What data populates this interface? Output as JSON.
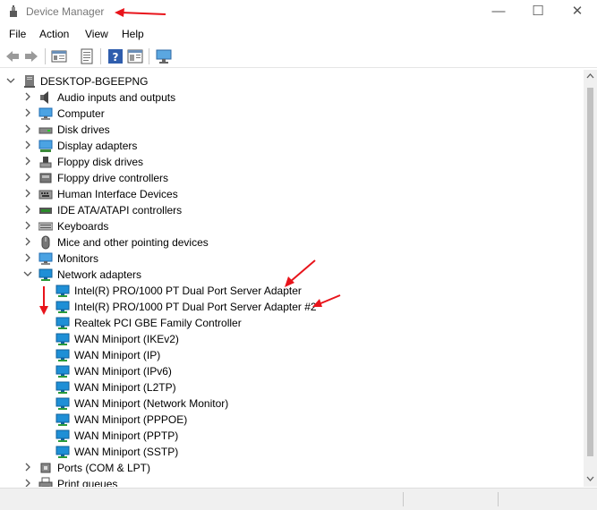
{
  "window": {
    "title": "Device Manager",
    "minimize_glyph": "—",
    "maximize_glyph": "☐",
    "close_glyph": "✕"
  },
  "menu": [
    "File",
    "Action",
    "View",
    "Help"
  ],
  "toolbar_icons": [
    "back-icon",
    "forward-icon",
    "properties-icon",
    "show-hidden-icon",
    "help-icon",
    "action-pane-icon",
    "monitor-icon"
  ],
  "tree": {
    "root": "DESKTOP-BGEEPNG",
    "categories": [
      {
        "label": "Audio inputs and outputs",
        "icon": "audio-icon"
      },
      {
        "label": "Computer",
        "icon": "computer-icon"
      },
      {
        "label": "Disk drives",
        "icon": "disk-drive-icon"
      },
      {
        "label": "Display adapters",
        "icon": "display-adapter-icon"
      },
      {
        "label": "Floppy disk drives",
        "icon": "floppy-disk-icon"
      },
      {
        "label": "Floppy drive controllers",
        "icon": "floppy-controller-icon"
      },
      {
        "label": "Human Interface Devices",
        "icon": "hid-icon"
      },
      {
        "label": "IDE ATA/ATAPI controllers",
        "icon": "ide-controller-icon"
      },
      {
        "label": "Keyboards",
        "icon": "keyboard-icon"
      },
      {
        "label": "Mice and other pointing devices",
        "icon": "mouse-icon"
      },
      {
        "label": "Monitors",
        "icon": "monitor-icon"
      },
      {
        "label": "Network adapters",
        "icon": "network-adapter-icon",
        "expanded": true
      },
      {
        "label": "Ports (COM & LPT)",
        "icon": "port-icon"
      },
      {
        "label": "Print queues",
        "icon": "printer-icon"
      }
    ],
    "network_adapters": [
      "Intel(R) PRO/1000 PT Dual Port Server Adapter",
      "Intel(R) PRO/1000 PT Dual Port Server Adapter #2",
      "Realtek PCI GBE Family Controller",
      "WAN Miniport (IKEv2)",
      "WAN Miniport (IP)",
      "WAN Miniport (IPv6)",
      "WAN Miniport (L2TP)",
      "WAN Miniport (Network Monitor)",
      "WAN Miniport (PPPOE)",
      "WAN Miniport (PPTP)",
      "WAN Miniport (SSTP)"
    ]
  },
  "colors": {
    "annotation": "#e8141b",
    "network_icon": "#1e8fd6",
    "tree_glyph": "#555555"
  }
}
